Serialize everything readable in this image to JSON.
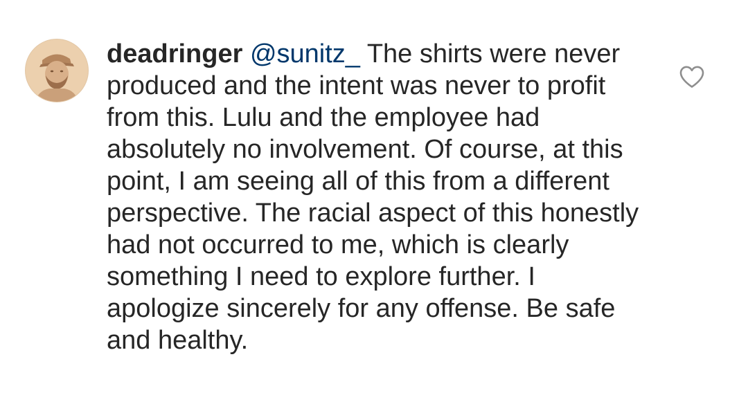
{
  "comment": {
    "username": "deadringer",
    "mention": "@sunitz_",
    "body": "The shirts were never produced and the intent was never to profit from this. Lulu and the employee had absolutely no involvement. Of course, at this point, I am seeing all of this from a different perspective. The racial aspect of this honestly had not occurred to me, which is clearly something I need to explore further. I apologize sincerely for any offense. Be safe and healthy.",
    "avatar_icon": "profile-photo",
    "like_icon": "heart-outline-icon"
  },
  "colors": {
    "text": "#262626",
    "mention": "#00376b",
    "icon": "#8e8e8e",
    "background": "#ffffff"
  }
}
